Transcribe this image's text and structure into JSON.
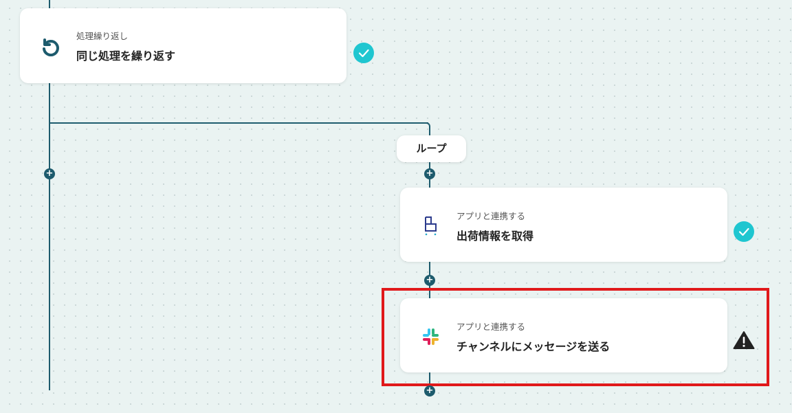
{
  "steps": {
    "repeat": {
      "subtitle": "処理繰り返し",
      "title": "同じ処理を繰り返す",
      "icon": "repeat-icon",
      "status": "completed"
    },
    "loop_label": "ループ",
    "get_shipping": {
      "subtitle": "アプリと連携する",
      "title": "出荷情報を取得",
      "icon": "logistics-app-icon",
      "status": "completed"
    },
    "send_message": {
      "subtitle": "アプリと連携する",
      "title": "チャンネルにメッセージを送る",
      "icon": "slack-icon",
      "status": "warning"
    }
  },
  "add_button_symbol": "+",
  "colors": {
    "connector": "#1d5b6d",
    "check": "#1fc6d0",
    "warning": "#222222",
    "highlight": "#e0191b"
  }
}
